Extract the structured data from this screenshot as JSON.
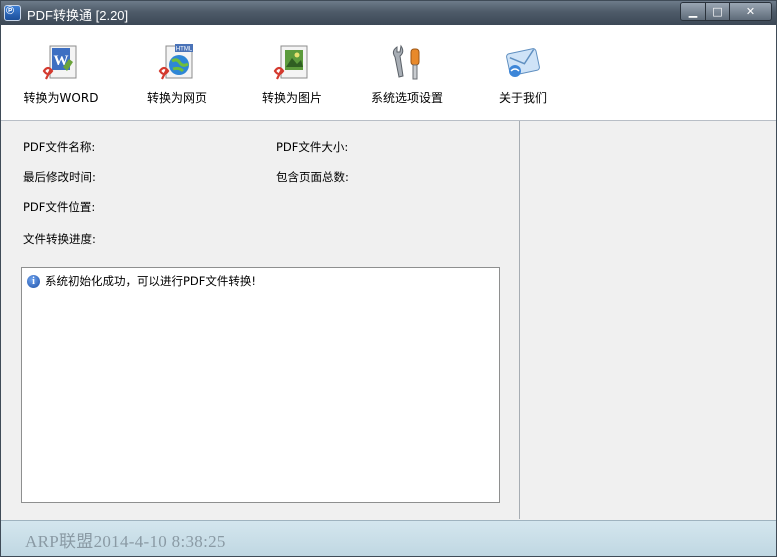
{
  "window": {
    "title": "PDF转换通 [2.20]",
    "min_glyph": "▁",
    "max_glyph": "□",
    "close_glyph": "✕"
  },
  "toolbar": {
    "items": [
      {
        "label": "转换为WORD",
        "icon": "pdf-to-word-icon"
      },
      {
        "label": "转换为网页",
        "icon": "pdf-to-html-icon",
        "badge": "HTML"
      },
      {
        "label": "转换为图片",
        "icon": "pdf-to-image-icon"
      },
      {
        "label": "系统选项设置",
        "icon": "settings-tools-icon"
      },
      {
        "label": "关于我们",
        "icon": "about-mail-icon"
      }
    ]
  },
  "fields": {
    "pdf_name": "PDF文件名称:",
    "pdf_size": "PDF文件大小:",
    "last_modified": "最后修改时间:",
    "page_count": "包含页面总数:",
    "pdf_location": "PDF文件位置:",
    "progress": "文件转换进度:"
  },
  "log": {
    "message": "系统初始化成功，可以进行PDF文件转换!"
  },
  "status": {
    "text": "ARP联盟2014-4-10 8:38:25"
  }
}
